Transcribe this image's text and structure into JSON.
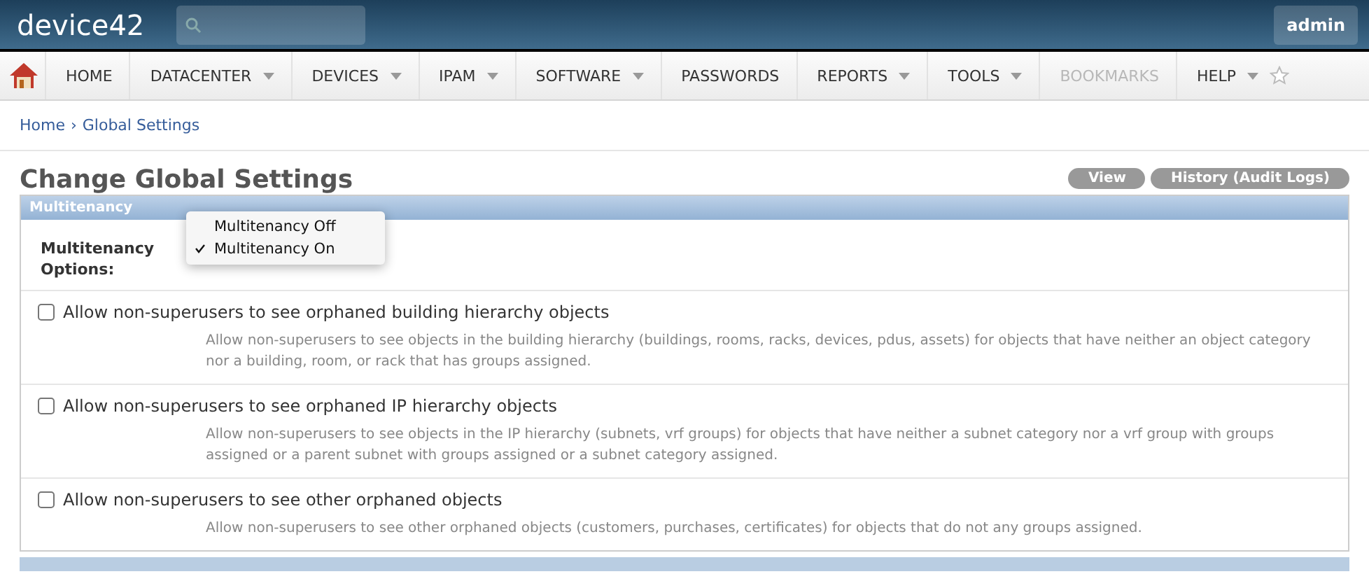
{
  "header": {
    "logo": "device42",
    "user": "admin"
  },
  "nav": [
    {
      "label": "HOME",
      "dropdown": false,
      "disabled": false
    },
    {
      "label": "DATACENTER",
      "dropdown": true,
      "disabled": false
    },
    {
      "label": "DEVICES",
      "dropdown": true,
      "disabled": false
    },
    {
      "label": "IPAM",
      "dropdown": true,
      "disabled": false
    },
    {
      "label": "SOFTWARE",
      "dropdown": true,
      "disabled": false
    },
    {
      "label": "PASSWORDS",
      "dropdown": false,
      "disabled": false
    },
    {
      "label": "REPORTS",
      "dropdown": true,
      "disabled": false
    },
    {
      "label": "TOOLS",
      "dropdown": true,
      "disabled": false
    },
    {
      "label": "BOOKMARKS",
      "dropdown": false,
      "disabled": true
    },
    {
      "label": "HELP",
      "dropdown": true,
      "disabled": false
    }
  ],
  "breadcrumb": {
    "separator": "›",
    "items": [
      "Home",
      "Global Settings"
    ]
  },
  "page_title": "Change Global Settings",
  "actions": [
    "View",
    "History (Audit Logs)"
  ],
  "section": {
    "title": "Multitenancy",
    "field_label": "Multitenancy Options:",
    "menu": [
      {
        "label": "Multitenancy Off",
        "selected": false
      },
      {
        "label": "Multitenancy On",
        "selected": true
      }
    ],
    "settings": [
      {
        "label": "Allow non-superusers to see orphaned building hierarchy objects",
        "checked": false,
        "help": "Allow non-superusers to see objects in the building hierarchy (buildings, rooms, racks, devices, pdus, assets) for objects that have neither an object category nor a building, room, or rack that has groups assigned."
      },
      {
        "label": "Allow non-superusers to see orphaned IP hierarchy objects",
        "checked": false,
        "help": "Allow non-superusers to see objects in the IP hierarchy (subnets, vrf groups) for objects that have neither a subnet category nor a vrf group with groups assigned or a parent subnet with groups assigned or a subnet category assigned."
      },
      {
        "label": "Allow non-superusers to see other orphaned objects",
        "checked": false,
        "help": "Allow non-superusers to see other orphaned objects (customers, purchases, certificates) for objects that do not any groups assigned."
      }
    ]
  }
}
